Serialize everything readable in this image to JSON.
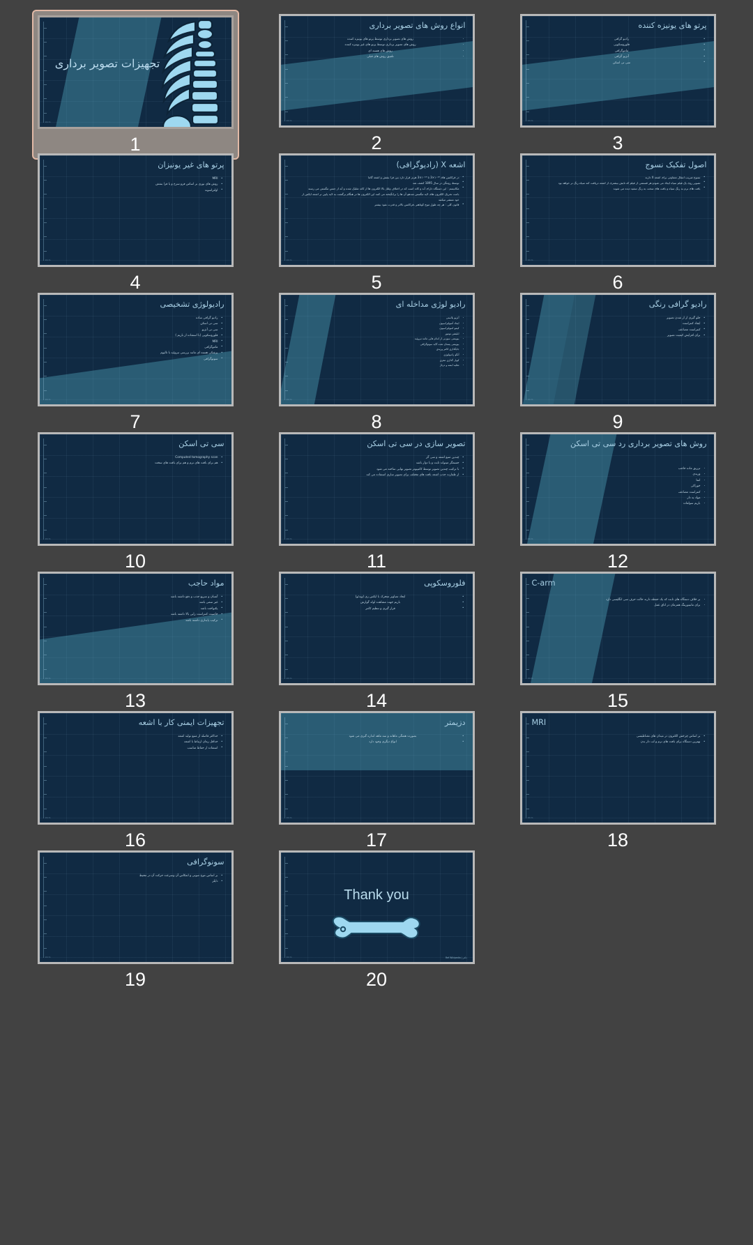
{
  "app": {
    "view": "slide-sorter",
    "background": "#424242",
    "selected_slide": 1,
    "slide_count": 20,
    "theme": {
      "slide_bg": "#102a43",
      "accent_band": "#2a5c74",
      "title_color": "#a8cfe4",
      "body_color": "#c6dbe8",
      "selection_border": "#e2b9a6",
      "selection_fill": "#8e8782",
      "thumb_frame": "#b9b9b9"
    },
    "ruler_label": "10cm"
  },
  "slides": [
    {
      "number": "1",
      "layout": "title",
      "selected": true,
      "title": "تجهیزات تصویر برداری",
      "bullets": [],
      "graphic": "xray-ribcage-spine-icon"
    },
    {
      "number": "2",
      "layout": "title-and-content",
      "selected": false,
      "title": "انواع روش های تصویر برداری",
      "bullets": [
        "روش های تصویر برداری توسط پرتو های یونیزه کننده",
        "روش های تصویر برداری توسط پرتو های غیر یونیزه کننده",
        "روش های هسته ای",
        "تلفیق روش های قبلی"
      ]
    },
    {
      "number": "3",
      "layout": "title-and-content",
      "selected": false,
      "title": "پرتو های یونیزه کننده",
      "bullets": [
        "رادیو گرافی",
        "فلوروسکوپی",
        "ماموگرافی",
        "آنژیو گرافی",
        "سی تی اسکن"
      ]
    },
    {
      "number": "4",
      "layout": "title-and-content",
      "selected": false,
      "title": "پرتو های غیر یونیزان",
      "bullets": [
        "MRI",
        "روش های نوری بر اساس فرو سرخ و یا فرا بنفش",
        "اولتراسوند"
      ]
    },
    {
      "number": "5",
      "layout": "title-and-content",
      "selected": false,
      "title": "اشعه  X  (رادیوگرافی)",
      "bullets": [
        "در فرکانس های ۱۰¹⁶×3 تا ۱۰¹⁹×3 هرتز قرار دارد بین فرا بنفش و اشعه گاما",
        "توسط رونتگن در سال 1895 کشف شد",
        "مکانیسم : این دستگاه دارای آند و کاتد است که در اختلاف ولتاژ بالا الکترون ها از کاتد شلیک شده و آند از جنس تنگستن می رسند باعث تحریک الکترون های لایه تنگستن شدهو آن ها را برانگیخته می کنند این الکترون ها در هنگام برگشت به لایه پایین تر اشعه ایکس از خود منتشر میکنند",
        "قانون کلی : هر چه طول موج کوتاهتر ،فرکانس بالاتر و قدرت نفوذ بیشتر"
      ]
    },
    {
      "number": "6",
      "layout": "title-and-content",
      "selected": false,
      "title": "اصول تفکیک نسوج",
      "bullets": [
        "نسوج ضریب انتقال متفاوتی برای اشعه X دارند",
        "تصویر روی یک فیلم سیاه ایجاد می شودو هر قسمتی از فیلم که تابش بیشتری از اشعه دریافت کند سیاه رنگ تر خواهد بود",
        "بافت های نرم به رنگ سیاه و بافت های سخت به رنگ سفید دیده می شوند"
      ]
    },
    {
      "number": "7",
      "layout": "title-and-content",
      "selected": false,
      "title": "رادیولوژی تشخیصی",
      "bullets": [
        "رادیو گرافی ساده",
        "سی تی اسکن",
        "سی تی آنژیو",
        "فلوروسکوپی (با استفاده از باریم )",
        "MRI",
        "ماموگرافی",
        "پزشکی هسته ای مانند بررسی تیروئید با تالیوم",
        "سونوگرافی"
      ]
    },
    {
      "number": "8",
      "layout": "title-and-content",
      "selected": false,
      "title": "رادیو لوژی مداخله ای",
      "bullets": [
        "آنژیو پلاستی",
        "ایجاد آمبولیزاسیون",
        "کیمو امبولیزاسیون",
        "ابلیشن تومور",
        "بیوپسی سوزنی از اندام هایی مانند تیروئید",
        "بیوپسی پستان تحت گاید سونوگرافی",
        "جایگذاری کاتتر وریدی",
        "آنگو رادیولوژی",
        "کویل گذاری مغزی",
        "تخلیه ابسه و درناژ"
      ]
    },
    {
      "number": "9",
      "layout": "title-and-content",
      "selected": false,
      "title": "رادیو گرافی رنگی",
      "bullets": [
        "جلو گیری از از شدن تصویر",
        "ایجاد کنتراست",
        "کنتراست مصاعف",
        "برای افزایش کیفیت تصویر"
      ]
    },
    {
      "number": "10",
      "layout": "title-and-content",
      "selected": false,
      "title": "سی تی اسکن",
      "bullets": [
        "Computed tomography scan",
        "هم برای بافت های نرم و هم برای بافت های سخت"
      ]
    },
    {
      "number": "11",
      "layout": "title-and-content",
      "selected": false,
      "title": "تصویر سازی در سی تی اسکن",
      "bullets": [
        "چندین منبع اشعه  و سی گر",
        "جسمگر میتواند ثابت و یا دوار باشد",
        "با ترکیب چندین تصویر توسط کامپیوتر تصویر نهایی ساخته می شود",
        "از ظفارت جذب اشعه بافت های مختلف برای تصویر سازی استفاده می کند"
      ]
    },
    {
      "number": "12",
      "layout": "title-and-content",
      "selected": false,
      "title": "روش های تصویر برداری رد سی تی اسکن",
      "bullets": [
        "تزریق ماده حاجب",
        "وریدی",
        "اتما",
        "خوراکی",
        "کنتراست مضاعف",
        "مواد ید دار",
        "باریم سولفات"
      ]
    },
    {
      "number": "13",
      "layout": "title-and-content",
      "selected": false,
      "title": "مواد حاجب",
      "bullets": [
        "آنسان و سریع جذب و دفع داشته باشد",
        "غیر سمی باشد",
        "یکنواخت باشد",
        "خاصیت کنتراست زایی بالا داشته باشد",
        "ترکیب پایداری داشته باشد"
      ]
    },
    {
      "number": "14",
      "layout": "title-and-content",
      "selected": false,
      "title": "فلوروسکوپی",
      "bullets": [
        "ایجاد تصاویر متحرک با ایکس ری (ویدئو)",
        "باریم جهت مشاهده لوله گوارش",
        "قرار گیری و تنظیم کاتتر"
      ]
    },
    {
      "number": "15",
      "layout": "title-and-content",
      "selected": false,
      "title": "C-arm",
      "title_ltr": true,
      "bullets": [
        "بر خلاف دستگاه های ثابت که یک حفظه دارند حالت حرف سی انگلیسی دارد",
        "برای مانیتورینگ همزمان در اتاق عمل"
      ]
    },
    {
      "number": "16",
      "layout": "title-and-content",
      "selected": false,
      "title": "تجهیزات ایمنی کار با اشعه",
      "bullets": [
        "حداکثر فاصله از منبع تولید اشعه",
        "حداقل زمان ارتباط با اشعه",
        "استفاده از حفاظ مناسب"
      ]
    },
    {
      "number": "17",
      "layout": "title-and-content",
      "selected": false,
      "title": "دزیمتر",
      "bullets": [
        "بصورت هفتگی ماهانه و سه ماهه اندازه گیری می شود",
        "انواع دیگری وجود دارد"
      ]
    },
    {
      "number": "18",
      "layout": "title-and-content",
      "selected": false,
      "title": "MRI",
      "title_ltr": true,
      "bullets": [
        "بر اساس چرخش الکترون در میدان های مغناطیسی",
        "بهترین دستگاه برای بافت های نرم  و لب دار بدن"
      ]
    },
    {
      "number": "19",
      "layout": "title-and-content",
      "selected": false,
      "title": "سونوگرافی",
      "bullets": [
        "بر اساس موج صوتی و انعکاس آن وسرعت حرکت آن در محیط",
        "داپلر"
      ]
    },
    {
      "number": "20",
      "layout": "closing",
      "selected": false,
      "title": "Thank you",
      "bullets": [],
      "footer": "Ref Wikipedia | دکتر",
      "graphic": "bone-icon"
    }
  ]
}
